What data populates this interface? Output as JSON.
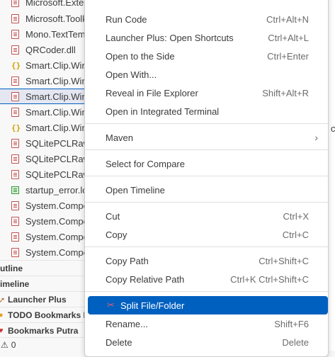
{
  "explorer": {
    "files": [
      {
        "name": "Microsoft.Extensions.Primitives.dll",
        "icon": "dll-file-icon"
      },
      {
        "name": "Microsoft.Toolkit",
        "icon": "dll-file-icon"
      },
      {
        "name": "Mono.TextTemplating",
        "icon": "dll-file-icon"
      },
      {
        "name": "QRCoder.dll",
        "icon": "dll-file-icon"
      },
      {
        "name": "Smart.Clip.Win",
        "icon": "json-file-icon"
      },
      {
        "name": "Smart.Clip.Win",
        "icon": "dll-file-icon"
      },
      {
        "name": "Smart.Clip.Win",
        "icon": "dll-file-icon"
      },
      {
        "name": "Smart.Clip.Win",
        "icon": "dll-file-icon"
      },
      {
        "name": "Smart.Clip.Win",
        "icon": "json-file-icon"
      },
      {
        "name": "SQLitePCLRaw",
        "icon": "dll-file-icon"
      },
      {
        "name": "SQLitePCLRaw",
        "icon": "dll-file-icon"
      },
      {
        "name": "SQLitePCLRaw",
        "icon": "dll-file-icon"
      },
      {
        "name": "startup_error.log",
        "icon": "log-file-icon"
      },
      {
        "name": "System.Compo",
        "icon": "dll-file-icon"
      },
      {
        "name": "System.Compo",
        "icon": "dll-file-icon"
      },
      {
        "name": "System.Compo",
        "icon": "dll-file-icon"
      },
      {
        "name": "System.Compo",
        "icon": "dll-file-icon"
      }
    ]
  },
  "panels": {
    "outline": "utline",
    "timeline": "imeline",
    "launcher_plus": "Launcher Plus",
    "todo_bookmarks": "TODO Bookmarks Pr",
    "bookmarks_putra": "Bookmarks Putra"
  },
  "status": {
    "problems_count": "0"
  },
  "editor_edge_text": "c",
  "context_menu": {
    "items": [
      {
        "label": "Run Code",
        "shortcut": "Ctrl+Alt+N"
      },
      {
        "label": "Launcher Plus: Open Shortcuts",
        "shortcut": "Ctrl+Alt+L"
      },
      {
        "label": "Open to the Side",
        "shortcut": "Ctrl+Enter"
      },
      {
        "label": "Open With...",
        "shortcut": ""
      },
      {
        "label": "Reveal in File Explorer",
        "shortcut": "Shift+Alt+R"
      },
      {
        "label": "Open in Integrated Terminal",
        "shortcut": ""
      },
      {
        "label": "Maven",
        "shortcut": ""
      },
      {
        "label": "Select for Compare",
        "shortcut": ""
      },
      {
        "label": "Open Timeline",
        "shortcut": ""
      },
      {
        "label": "Cut",
        "shortcut": "Ctrl+X"
      },
      {
        "label": "Copy",
        "shortcut": "Ctrl+C"
      },
      {
        "label": "Copy Path",
        "shortcut": "Ctrl+Shift+C"
      },
      {
        "label": "Copy Relative Path",
        "shortcut": "Ctrl+K Ctrl+Shift+C"
      },
      {
        "label": "Split File/Folder",
        "shortcut": ""
      },
      {
        "label": "Rename...",
        "shortcut": "Shift+F6"
      },
      {
        "label": "Delete",
        "shortcut": "Delete"
      }
    ]
  },
  "colors": {
    "accent": "#0060c0",
    "menu_bg": "#ffffff",
    "sidebar_bg": "#f8f8f8",
    "dll_icon": "#c0504d",
    "json_icon": "#d4a000",
    "log_icon": "#3a9c3a"
  }
}
